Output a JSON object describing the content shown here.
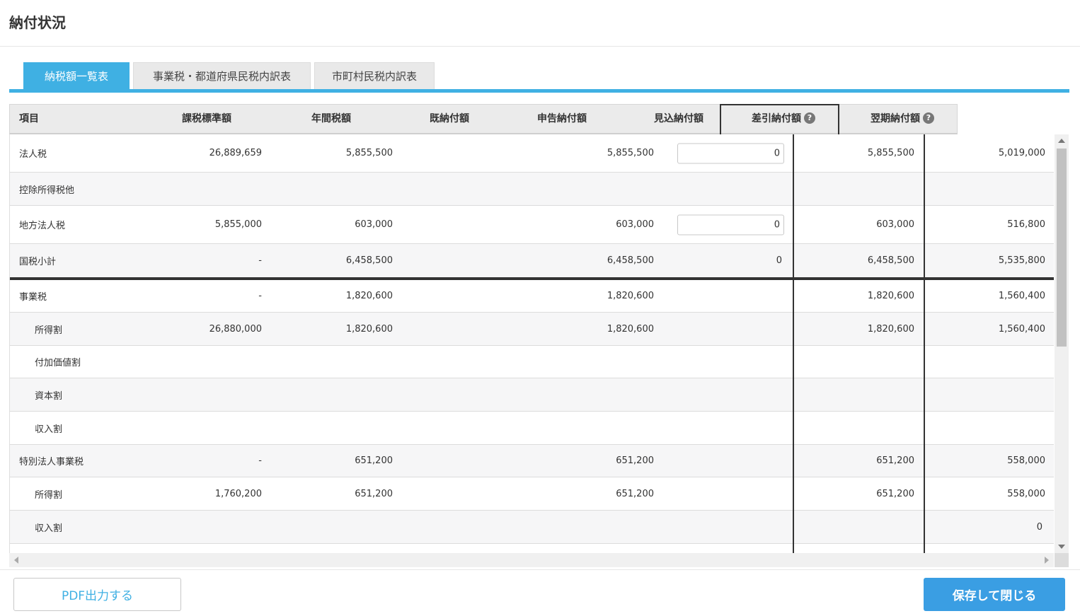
{
  "page": {
    "title": "納付状況"
  },
  "tabs": [
    {
      "label": "納税額一覧表",
      "active": true
    },
    {
      "label": "事業税・都道府県民税内訳表",
      "active": false
    },
    {
      "label": "市町村民税内訳表",
      "active": false
    }
  ],
  "table": {
    "headers": [
      "項目",
      "課税標準額",
      "年間税額",
      "既納付額",
      "申告納付額",
      "見込納付額",
      "差引納付額",
      "翌期納付額"
    ],
    "rows": [
      {
        "item": "法人税",
        "base": "26,889,659",
        "annual": "5,855,500",
        "paid": "",
        "declared": "5,855,500",
        "estimate_input": "0",
        "diff": "5,855,500",
        "next": "5,019,000"
      },
      {
        "item": "控除所得税他",
        "base": "",
        "annual": "",
        "paid": "",
        "declared": "",
        "estimate": "",
        "diff": "",
        "next": ""
      },
      {
        "item": "地方法人税",
        "base": "5,855,000",
        "annual": "603,000",
        "paid": "",
        "declared": "603,000",
        "estimate_input": "0",
        "diff": "603,000",
        "next": "516,800"
      },
      {
        "item": "国税小計",
        "base": "-",
        "annual": "6,458,500",
        "paid": "",
        "declared": "6,458,500",
        "estimate": "0",
        "diff": "6,458,500",
        "next": "5,535,800"
      },
      {
        "item": "事業税",
        "base": "-",
        "annual": "1,820,600",
        "paid": "",
        "declared": "1,820,600",
        "estimate": "",
        "diff": "1,820,600",
        "next": "1,560,400"
      },
      {
        "item": "所得割",
        "base": "26,880,000",
        "annual": "1,820,600",
        "paid": "",
        "declared": "1,820,600",
        "estimate": "",
        "diff": "1,820,600",
        "next": "1,560,400"
      },
      {
        "item": "付加価値割",
        "base": "",
        "annual": "",
        "paid": "",
        "declared": "",
        "estimate": "",
        "diff": "",
        "next": ""
      },
      {
        "item": "資本割",
        "base": "",
        "annual": "",
        "paid": "",
        "declared": "",
        "estimate": "",
        "diff": "",
        "next": ""
      },
      {
        "item": "収入割",
        "base": "",
        "annual": "",
        "paid": "",
        "declared": "",
        "estimate": "",
        "diff": "",
        "next": ""
      },
      {
        "item": "特別法人事業税",
        "base": "-",
        "annual": "651,200",
        "paid": "",
        "declared": "651,200",
        "estimate": "",
        "diff": "651,200",
        "next": "558,000"
      },
      {
        "item": "所得割",
        "base": "1,760,200",
        "annual": "651,200",
        "paid": "",
        "declared": "651,200",
        "estimate": "",
        "diff": "651,200",
        "next": "558,000"
      },
      {
        "item": "収入割",
        "base": "",
        "annual": "",
        "paid": "",
        "declared": "",
        "estimate": "",
        "diff": "",
        "next": "0"
      }
    ]
  },
  "icons": {
    "help": "help-icon"
  },
  "footer": {
    "pdf_label": "PDF出力する",
    "save_label": "保存して閉じる"
  },
  "colors": {
    "accent": "#3fb0e3",
    "save_button": "#3a9ee3"
  }
}
